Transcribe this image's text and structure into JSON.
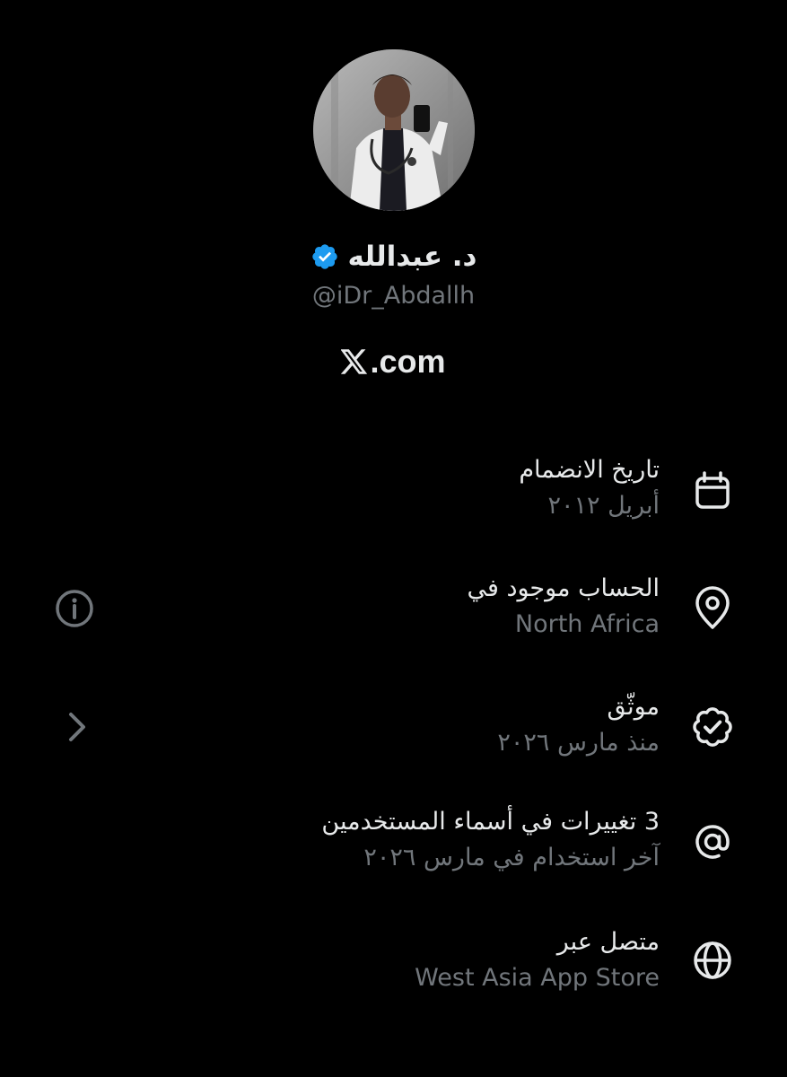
{
  "profile": {
    "display_name": "د. عبدالله",
    "handle": "@iDr_Abdallh",
    "verified_icon": "verified-badge-icon",
    "avatar_icon": "profile-photo"
  },
  "brand": {
    "logo_icon": "x-logo-icon",
    "domain": ".com"
  },
  "about_rows": [
    {
      "title": "تاريخ الانضمام",
      "subtitle": "أبريل ٢٠١٢",
      "icon": "calendar-icon"
    },
    {
      "title": "الحساب موجود في",
      "subtitle": "North Africa",
      "icon": "location-pin-icon",
      "side_icon": "info-icon"
    },
    {
      "title": "موثّق",
      "subtitle": "منذ مارس ٢٠٢٦",
      "icon": "verified-outline-icon",
      "side_icon": "chevron-right-icon"
    },
    {
      "title": "3 تغييرات في أسماء المستخدمين",
      "subtitle": "آخر استخدام في مارس ٢٠٢٦",
      "icon": "at-sign-icon"
    },
    {
      "title": "متصل عبر",
      "subtitle": "West Asia App Store",
      "icon": "globe-icon"
    }
  ],
  "colors": {
    "background": "#000000",
    "primary_text": "#e7e9ea",
    "secondary_text": "#71767b",
    "verified_blue": "#1d9bf0"
  }
}
